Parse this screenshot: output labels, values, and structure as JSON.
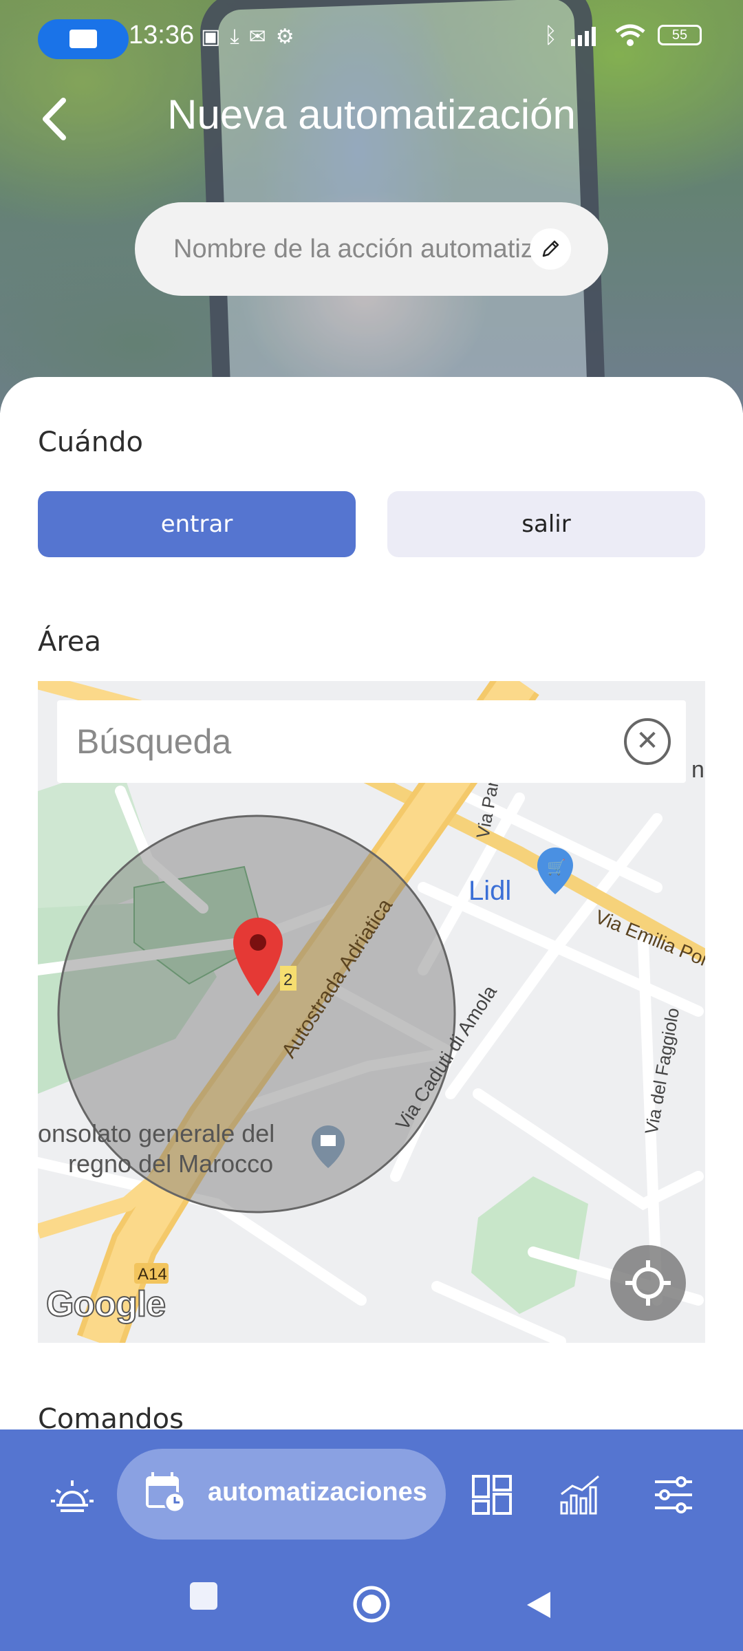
{
  "status_bar": {
    "time": "13:36",
    "battery": "55",
    "icons": [
      "screen-record-icon",
      "nfc-icon",
      "download-icon",
      "mail-icon",
      "vpn-icon",
      "bluetooth-icon",
      "signal-icon",
      "wifi-icon"
    ]
  },
  "header": {
    "title": "Nueva automatización",
    "name_placeholder": "Nombre de la acción automatizada"
  },
  "when": {
    "label": "Cuándo",
    "options": [
      "entrar",
      "salir"
    ],
    "selected": "entrar"
  },
  "area": {
    "label": "Área",
    "search_placeholder": "Búsqueda",
    "map_labels": {
      "road_1": "Autostrada Adriatica",
      "road_2": "Via Caduti di Amola",
      "road_3": "Via Emilia Pone",
      "road_4": "Via del Faggiolo",
      "road_5": "Via Par",
      "shop": "Lidl",
      "place": "onsolato generale del regno del Marocco",
      "highway_badge": "A14",
      "lane_badge": "2",
      "edge": "ne",
      "attribution": "Google"
    }
  },
  "commands": {
    "label": "Comandos"
  },
  "bottom_nav": {
    "items": [
      "scenes-icon",
      "automations-icon",
      "dashboard-icon",
      "statistics-icon",
      "settings-icon"
    ],
    "active_label": "automatizaciones"
  },
  "colors": {
    "primary": "#5575d0",
    "nav_active": "#8aa1e2",
    "segment_inactive": "#ececf6",
    "marker": "#e53935"
  }
}
